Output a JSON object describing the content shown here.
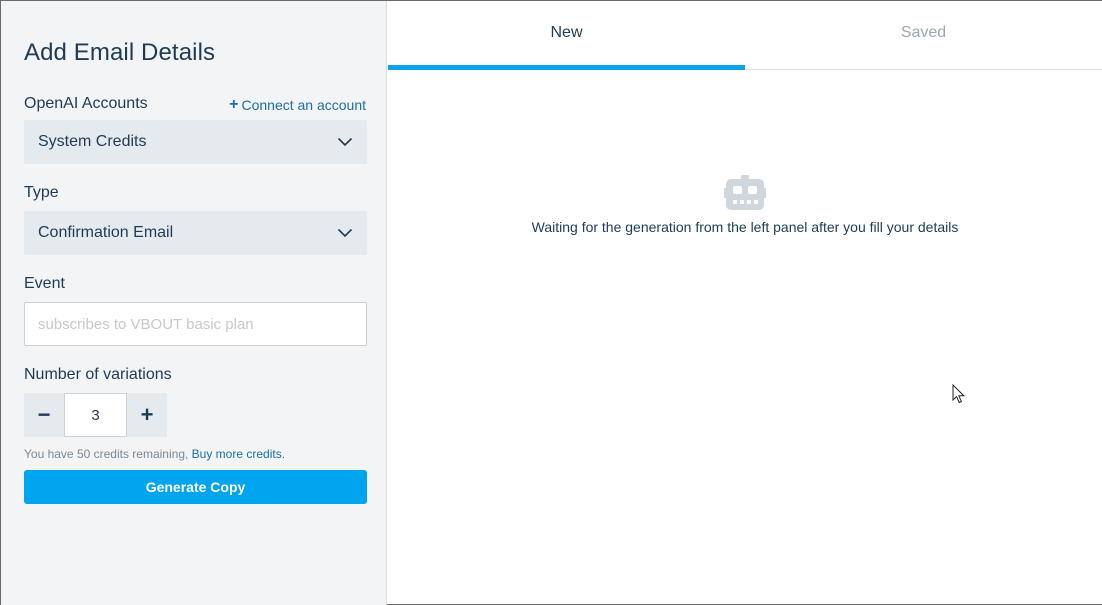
{
  "left_panel": {
    "title": "Add Email Details",
    "accounts": {
      "label": "OpenAI Accounts",
      "connect_plus": "+",
      "connect_label": "Connect an account",
      "selected": "System Credits"
    },
    "type": {
      "label": "Type",
      "selected": "Confirmation Email"
    },
    "event": {
      "label": "Event",
      "value": "",
      "placeholder": "subscribes to VBOUT basic plan"
    },
    "variations": {
      "label": "Number of variations",
      "minus": "−",
      "value": "3",
      "plus": "+"
    },
    "credits": {
      "text": "You have 50 credits remaining,",
      "link": "Buy more credits."
    },
    "generate_label": "Generate Copy"
  },
  "right_panel": {
    "tabs": [
      {
        "label": "New",
        "active": true
      },
      {
        "label": "Saved",
        "active": false
      }
    ],
    "empty_state": {
      "icon": "robot-icon",
      "text": "Waiting for the generation from the left panel after you fill your details"
    }
  },
  "colors": {
    "accent": "#00a4ef",
    "text": "#1f3a55",
    "link": "#1c6ea4",
    "panel_bg": "#f3f4f5",
    "field_bg": "#e5eaee"
  }
}
